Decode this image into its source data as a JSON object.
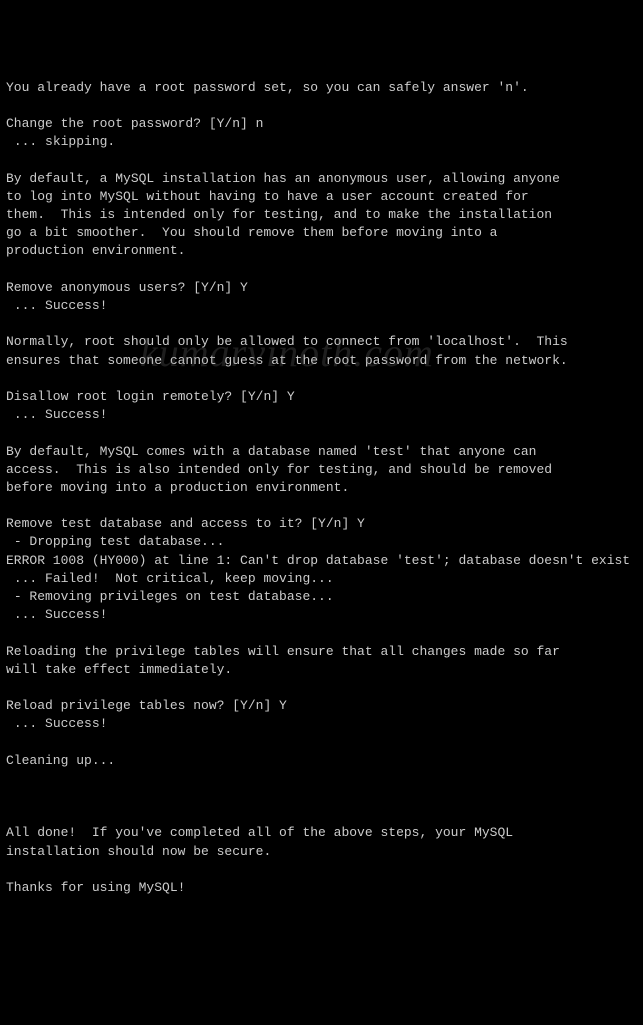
{
  "watermark": "kumarvinoth.com",
  "terminal": {
    "lines": [
      "You already have a root password set, so you can safely answer 'n'.",
      "",
      "Change the root password? [Y/n] n",
      " ... skipping.",
      "",
      "By default, a MySQL installation has an anonymous user, allowing anyone",
      "to log into MySQL without having to have a user account created for",
      "them.  This is intended only for testing, and to make the installation",
      "go a bit smoother.  You should remove them before moving into a",
      "production environment.",
      "",
      "Remove anonymous users? [Y/n] Y",
      " ... Success!",
      "",
      "Normally, root should only be allowed to connect from 'localhost'.  This",
      "ensures that someone cannot guess at the root password from the network.",
      "",
      "Disallow root login remotely? [Y/n] Y",
      " ... Success!",
      "",
      "By default, MySQL comes with a database named 'test' that anyone can",
      "access.  This is also intended only for testing, and should be removed",
      "before moving into a production environment.",
      "",
      "Remove test database and access to it? [Y/n] Y",
      " - Dropping test database...",
      "ERROR 1008 (HY000) at line 1: Can't drop database 'test'; database doesn't exist",
      " ... Failed!  Not critical, keep moving...",
      " - Removing privileges on test database...",
      " ... Success!",
      "",
      "Reloading the privilege tables will ensure that all changes made so far",
      "will take effect immediately.",
      "",
      "Reload privilege tables now? [Y/n] Y",
      " ... Success!",
      "",
      "Cleaning up...",
      "",
      "",
      "",
      "All done!  If you've completed all of the above steps, your MySQL",
      "installation should now be secure.",
      "",
      "Thanks for using MySQL!"
    ]
  }
}
